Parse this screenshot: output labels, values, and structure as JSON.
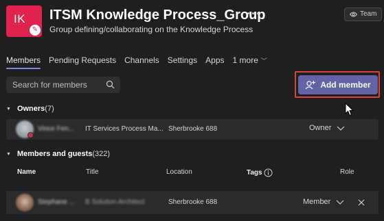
{
  "team": {
    "initials": "IK",
    "name": "ITSM Knowledge Process_Group",
    "description": "Group defining/collaborating on the Knowledge Process",
    "badge": "Team",
    "avatar_color": "#e0234e"
  },
  "tabs": [
    {
      "label": "Members",
      "active": true
    },
    {
      "label": "Pending Requests"
    },
    {
      "label": "Channels"
    },
    {
      "label": "Settings"
    },
    {
      "label": "Apps"
    },
    {
      "label": "1 more"
    }
  ],
  "search": {
    "placeholder": "Search for members"
  },
  "add_member": {
    "label": "Add member",
    "color": "#6264a7",
    "highlight_color": "#e0413a"
  },
  "owners": {
    "title": "Owners",
    "count": "(7)",
    "rows": [
      {
        "name": "Vince Fen...",
        "title": "IT Services Process Ma...",
        "location": "Sherbrooke 688",
        "role": "Owner"
      }
    ]
  },
  "members": {
    "title": "Members and guests",
    "count": "(322)",
    "columns": {
      "name": "Name",
      "title": "Title",
      "location": "Location",
      "tags": "Tags",
      "role": "Role"
    },
    "rows": [
      {
        "name": "Stephane ...",
        "title": "B Solution Architect",
        "location": "Sherbrooke 688",
        "role": "Member"
      }
    ]
  }
}
